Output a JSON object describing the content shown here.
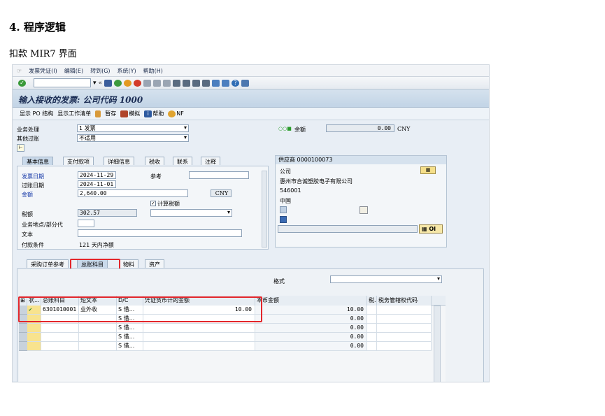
{
  "doc": {
    "heading": "4.  程序逻辑",
    "subheading": "扣款 MIR7 界面"
  },
  "menu": [
    "发票凭证(I)",
    "编辑(E)",
    "转到(G)",
    "系统(Y)",
    "帮助(H)"
  ],
  "title": "输入接收的发票: 公司代码 1000",
  "app_toolbar": [
    "显示 PO 结构",
    "显示工作清单",
    "暂存",
    "模拟",
    "帮助",
    "NF"
  ],
  "header": {
    "business_label": "业务处理",
    "business_value": "1 发票",
    "other_label": "其他过账",
    "other_value": "不适用",
    "balance_label": "余额",
    "balance_value": "0.00",
    "balance_currency": "CNY"
  },
  "tabs": [
    "基本信息",
    "支付款项",
    "详细信息",
    "税收",
    "联系",
    "注释"
  ],
  "basic": {
    "invoice_date_label": "发票日期",
    "invoice_date": "2024-11-29",
    "reference_label": "参考",
    "posting_date_label": "过账日期",
    "posting_date": "2024-11-01",
    "amount_label": "金额",
    "amount": "2,640.00",
    "currency": "CNY",
    "calc_tax_label": "计算税额",
    "tax_label": "税额",
    "tax_value": "302.57",
    "bizplace_label": "业务地点/部分代",
    "text_label": "文本",
    "payterm_label": "付款条件",
    "payterm_value": "121 天内净额"
  },
  "vendor": {
    "header": "供应商 0000100073",
    "company_label": "公司",
    "name": "惠州市合诚塑胶电子有限公司",
    "postcode": "546001",
    "country": "中国",
    "oi_label": "OI"
  },
  "lower_tabs": [
    "采购订单参考",
    "总账科目",
    "物料",
    "资产"
  ],
  "layout_label": "格式",
  "grid": {
    "headers": [
      "状...",
      "总账科目",
      "短文本",
      "D/C",
      "凭证货币计的金额",
      "本币金额",
      "税.",
      "税务管辖权代码"
    ],
    "rows": [
      {
        "account": "6301010001",
        "text": "业外收入-...",
        "dc": "S 借...",
        "amount": "10.00",
        "local": "10.00"
      },
      {
        "account": "",
        "text": "",
        "dc": "S 借...",
        "amount": "",
        "local": "0.00"
      },
      {
        "account": "",
        "text": "",
        "dc": "S 借...",
        "amount": "",
        "local": "0.00"
      },
      {
        "account": "",
        "text": "",
        "dc": "S 借...",
        "amount": "",
        "local": "0.00"
      },
      {
        "account": "",
        "text": "",
        "dc": "S 借...",
        "amount": "",
        "local": "0.00"
      }
    ]
  },
  "colors": {
    "highlight": "#e3262b",
    "title_bg": "#c2d4e6"
  }
}
